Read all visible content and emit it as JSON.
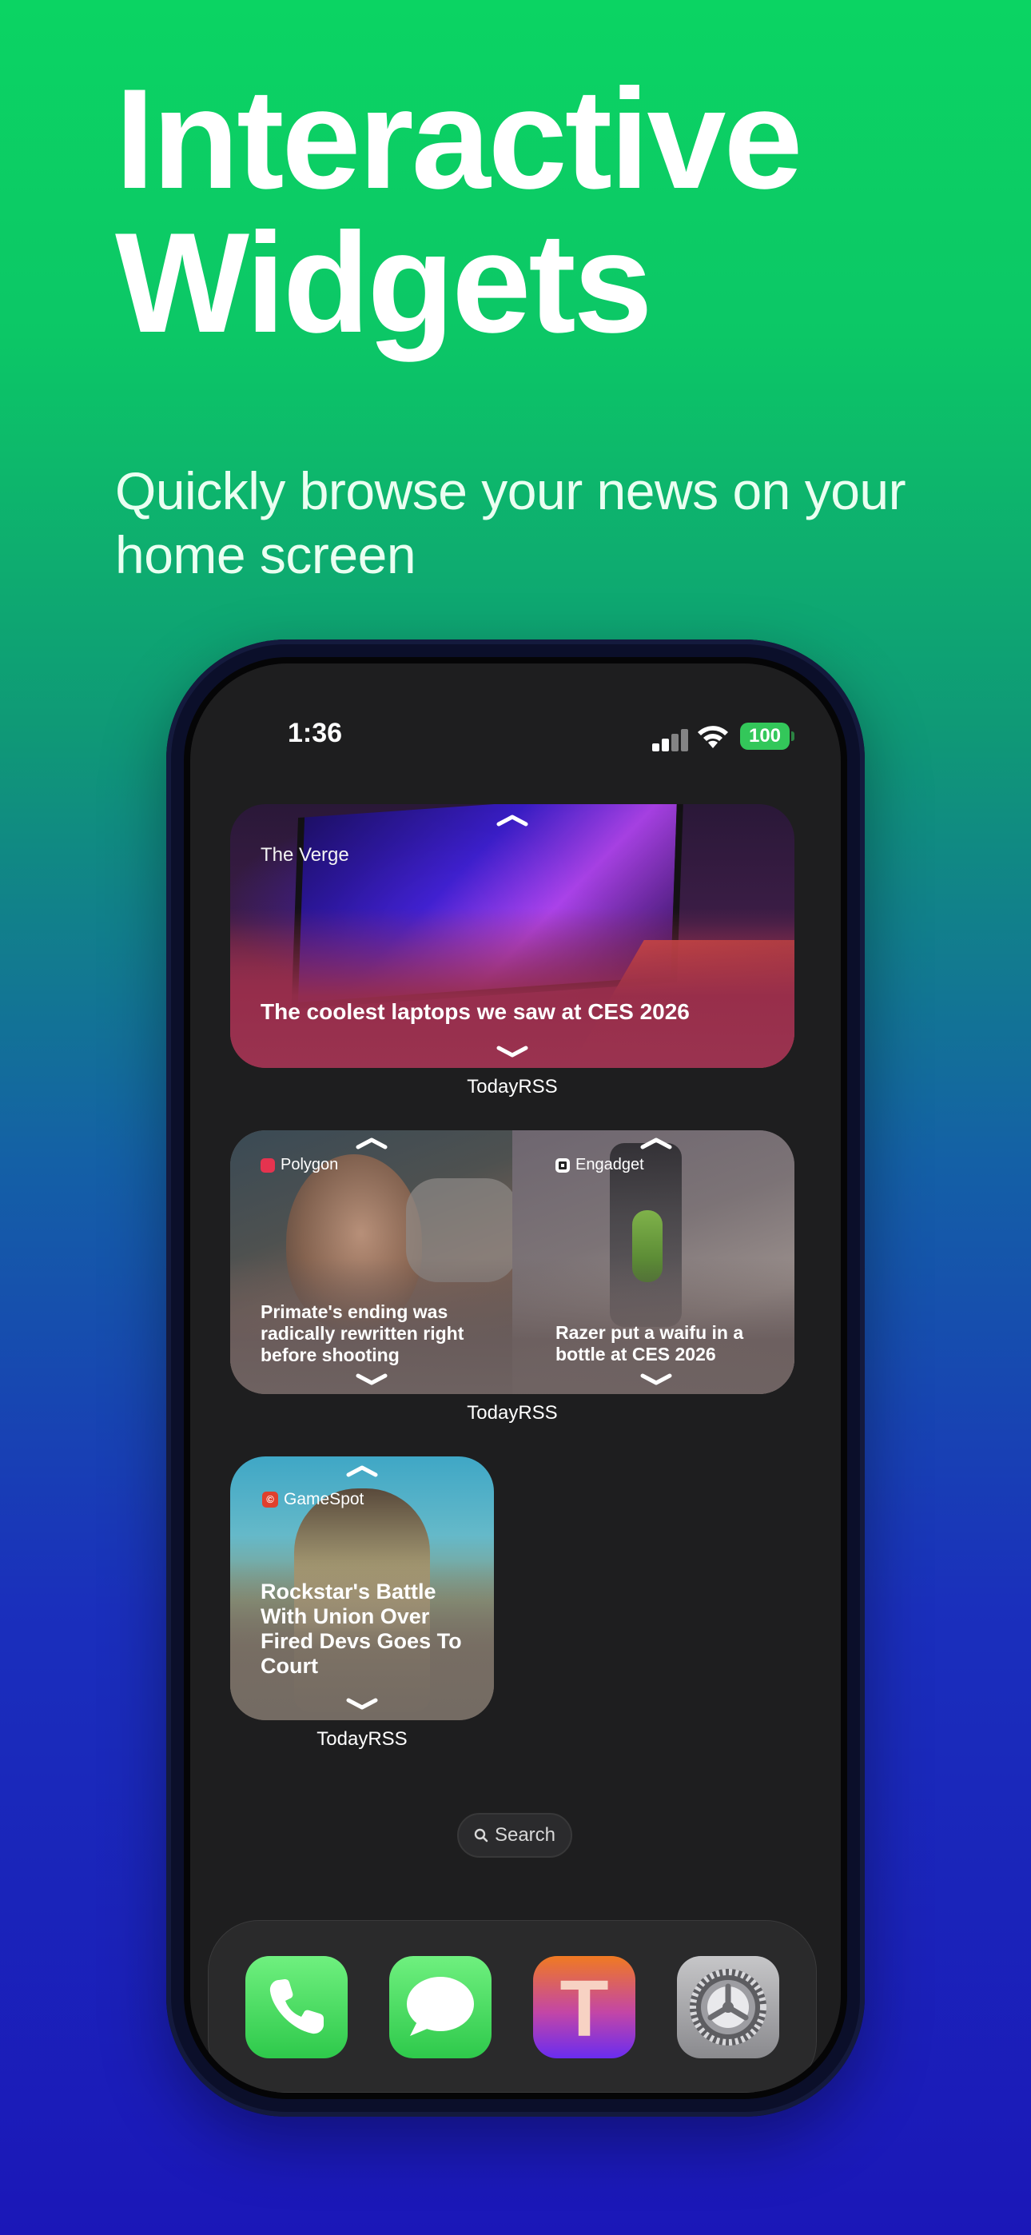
{
  "hero": {
    "title_line1": "Interactive",
    "title_line2": "Widgets",
    "subtitle": "Quickly browse your news on your home screen"
  },
  "status_bar": {
    "time": "1:36",
    "battery": "100"
  },
  "widgets": [
    {
      "source": "The Verge",
      "headline": "The coolest laptops we saw at CES 2026",
      "label": "TodayRSS"
    },
    {
      "left": {
        "source": "Polygon",
        "headline": "Primate's ending was radically rewritten right before shooting"
      },
      "right": {
        "source": "Engadget",
        "headline": "Razer put a waifu in a bottle at CES 2026"
      },
      "label": "TodayRSS"
    },
    {
      "source": "GameSpot",
      "headline": "Rockstar's Battle With Union Over Fired Devs Goes To Court",
      "label": "TodayRSS"
    }
  ],
  "search": {
    "label": "Search"
  },
  "dock": {
    "apps": [
      "phone-icon",
      "messages-icon",
      "todayrss-icon",
      "settings-icon"
    ],
    "todayrss_letter": "T"
  },
  "colors": {
    "battery": "#33c75a",
    "gamespot_badge": "#e0402d",
    "polygon_badge": "#e5334f"
  }
}
